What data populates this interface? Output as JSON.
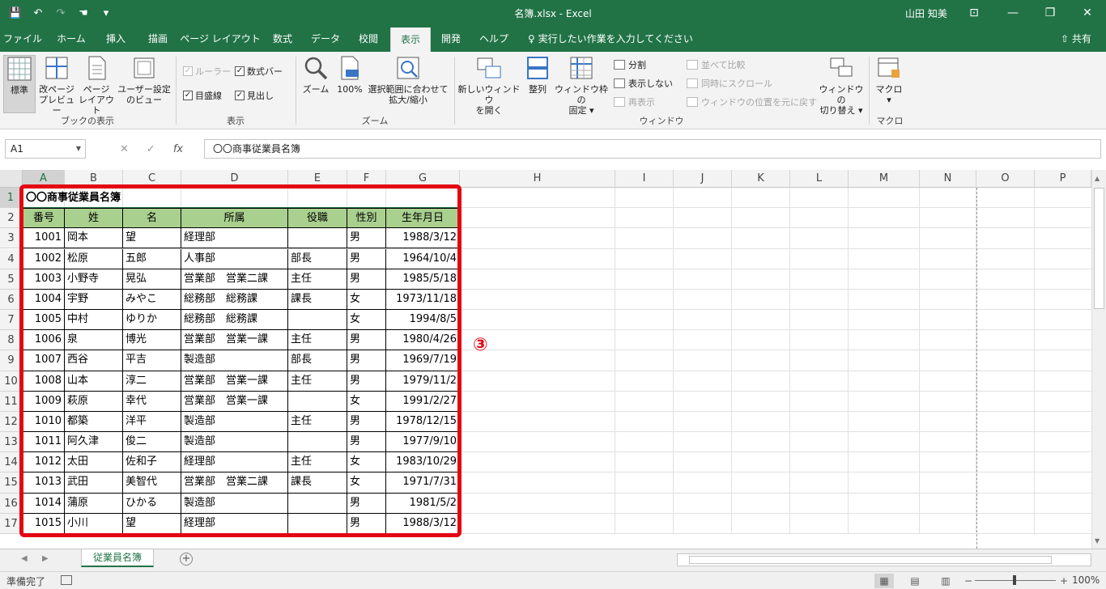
{
  "titlebar": {
    "title": "名簿.xlsx  -  Excel",
    "user": "山田 知美",
    "qat": {
      "save_icon": "💾",
      "undo_icon": "↶",
      "redo_icon": "↷",
      "touch_icon": "☚",
      "customize_icon": "▾"
    },
    "window_buttons": {
      "ribbon_options": "⊡",
      "minimize": "—",
      "restore": "❐",
      "close": "✕"
    }
  },
  "tabs": [
    "ファイル",
    "ホーム",
    "挿入",
    "描画",
    "ページ レイアウト",
    "数式",
    "データ",
    "校閲",
    "表示",
    "開発",
    "ヘルプ"
  ],
  "active_tab": "表示",
  "tellme": "♀ 実行したい作業を入力してください",
  "share": "⇧ 共有",
  "ribbon": {
    "workbook_views": {
      "label": "ブックの表示",
      "normal": "標準",
      "page_break_1": "改ページ",
      "page_break_2": "プレビュー",
      "page_layout_1": "ページ",
      "page_layout_2": "レイアウト",
      "custom_1": "ユーザー設定",
      "custom_2": "のビュー"
    },
    "show": {
      "label": "表示",
      "ruler": "ルーラー",
      "formula_bar": "数式バー",
      "gridlines": "目盛線",
      "headings": "見出し"
    },
    "zoom": {
      "label": "ズーム",
      "zoom": "ズーム",
      "zoom100": "100%",
      "fit_1": "選択範囲に合わせて",
      "fit_2": "拡大/縮小"
    },
    "window": {
      "label": "ウィンドウ",
      "new_1": "新しいウィンドウ",
      "new_2": "を開く",
      "arrange": "整列",
      "freeze_1": "ウィンドウ枠の",
      "freeze_2": "固定 ▾",
      "split": "分割",
      "hide": "表示しない",
      "unhide": "再表示",
      "side_by_side": "並べて比較",
      "sync_scroll": "同時にスクロール",
      "reset_pos": "ウィンドウの位置を元に戻す",
      "switch_1": "ウィンドウの",
      "switch_2": "切り替え ▾"
    },
    "macros": {
      "label": "マクロ",
      "macro_1": "マクロ",
      "macro_2": "▾"
    }
  },
  "formula_bar": {
    "name_box": "A1",
    "cancel_icon": "✕",
    "enter_icon": "✓",
    "fx_icon": "fx",
    "content": "〇〇商事従業員名簿"
  },
  "columns": [
    "A",
    "B",
    "C",
    "D",
    "E",
    "F",
    "G",
    "H",
    "I",
    "J",
    "K",
    "L",
    "M",
    "N",
    "O",
    "P"
  ],
  "rows": [
    "1",
    "2",
    "3",
    "4",
    "5",
    "6",
    "7",
    "8",
    "9",
    "10",
    "11",
    "12",
    "13",
    "14",
    "15",
    "16",
    "17"
  ],
  "sheet_title": "〇〇商事従業員名簿",
  "table_headers": [
    "番号",
    "姓",
    "名",
    "所属",
    "役職",
    "性別",
    "生年月日"
  ],
  "table_rows": [
    [
      "1001",
      "岡本",
      "望",
      "経理部",
      "",
      "男",
      "1988/3/12"
    ],
    [
      "1002",
      "松原",
      "五郎",
      "人事部",
      "部長",
      "男",
      "1964/10/4"
    ],
    [
      "1003",
      "小野寺",
      "晃弘",
      "営業部　営業二課",
      "主任",
      "男",
      "1985/5/18"
    ],
    [
      "1004",
      "宇野",
      "みやこ",
      "総務部　総務課",
      "課長",
      "女",
      "1973/11/18"
    ],
    [
      "1005",
      "中村",
      "ゆりか",
      "総務部　総務課",
      "",
      "女",
      "1994/8/5"
    ],
    [
      "1006",
      "泉",
      "博光",
      "営業部　営業一課",
      "主任",
      "男",
      "1980/4/26"
    ],
    [
      "1007",
      "西谷",
      "平吉",
      "製造部",
      "部長",
      "男",
      "1969/7/19"
    ],
    [
      "1008",
      "山本",
      "淳二",
      "営業部　営業一課",
      "主任",
      "男",
      "1979/11/2"
    ],
    [
      "1009",
      "萩原",
      "幸代",
      "営業部　営業一課",
      "",
      "女",
      "1991/2/27"
    ],
    [
      "1010",
      "都築",
      "洋平",
      "製造部",
      "主任",
      "男",
      "1978/12/15"
    ],
    [
      "1011",
      "阿久津",
      "俊二",
      "製造部",
      "",
      "男",
      "1977/9/10"
    ],
    [
      "1012",
      "太田",
      "佐和子",
      "経理部",
      "主任",
      "女",
      "1983/10/29"
    ],
    [
      "1013",
      "武田",
      "美智代",
      "営業部　営業二課",
      "課長",
      "女",
      "1971/7/31"
    ],
    [
      "1014",
      "蒲原",
      "ひかる",
      "製造部",
      "",
      "男",
      "1981/5/2"
    ],
    [
      "1015",
      "小川",
      "望",
      "経理部",
      "",
      "男",
      "1988/3/12"
    ]
  ],
  "annotation": "③",
  "sheet_tab": "従業員名簿",
  "add_sheet": "+",
  "status": {
    "text": "準備完了",
    "zoom": "100%",
    "view_normal_icon": "▦",
    "view_layout_icon": "▤",
    "view_break_icon": "▥",
    "zoom_out": "−",
    "zoom_in": "+"
  },
  "colors": {
    "excel_green": "#217346",
    "header_fill": "#a9d08e",
    "highlight_red": "#e30613"
  }
}
